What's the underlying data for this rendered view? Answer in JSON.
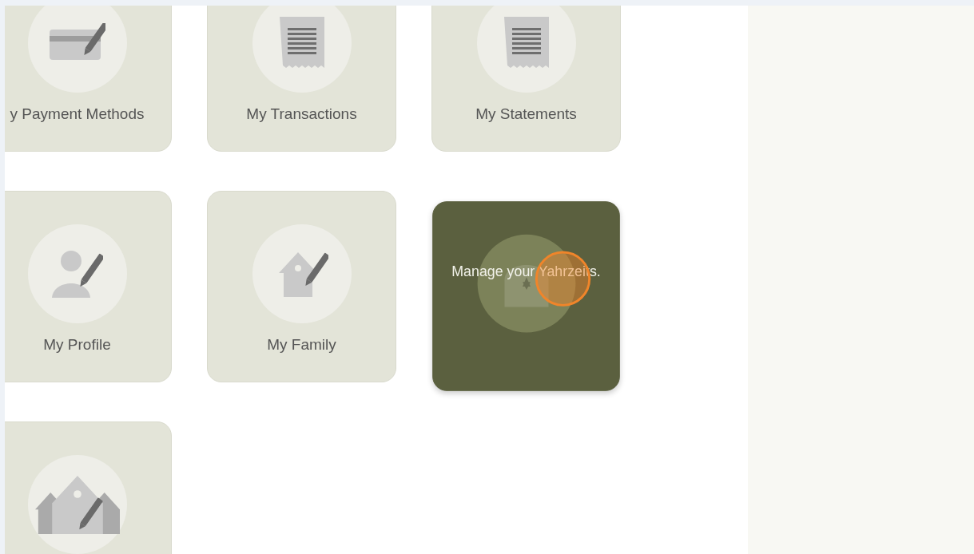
{
  "tiles": [
    {
      "kind": "card",
      "label": "y Payment Methods",
      "hovered": false
    },
    {
      "kind": "receipt",
      "label": "My Transactions",
      "hovered": false
    },
    {
      "kind": "receipt",
      "label": "My Statements",
      "hovered": false
    },
    {
      "kind": "person",
      "label": "My Profile",
      "hovered": false
    },
    {
      "kind": "house",
      "label": "My Family",
      "hovered": false
    },
    {
      "kind": "memorial",
      "label": "Manage your Yahrzeits.",
      "hovered": true
    },
    {
      "kind": "houses",
      "hovered": false
    }
  ]
}
